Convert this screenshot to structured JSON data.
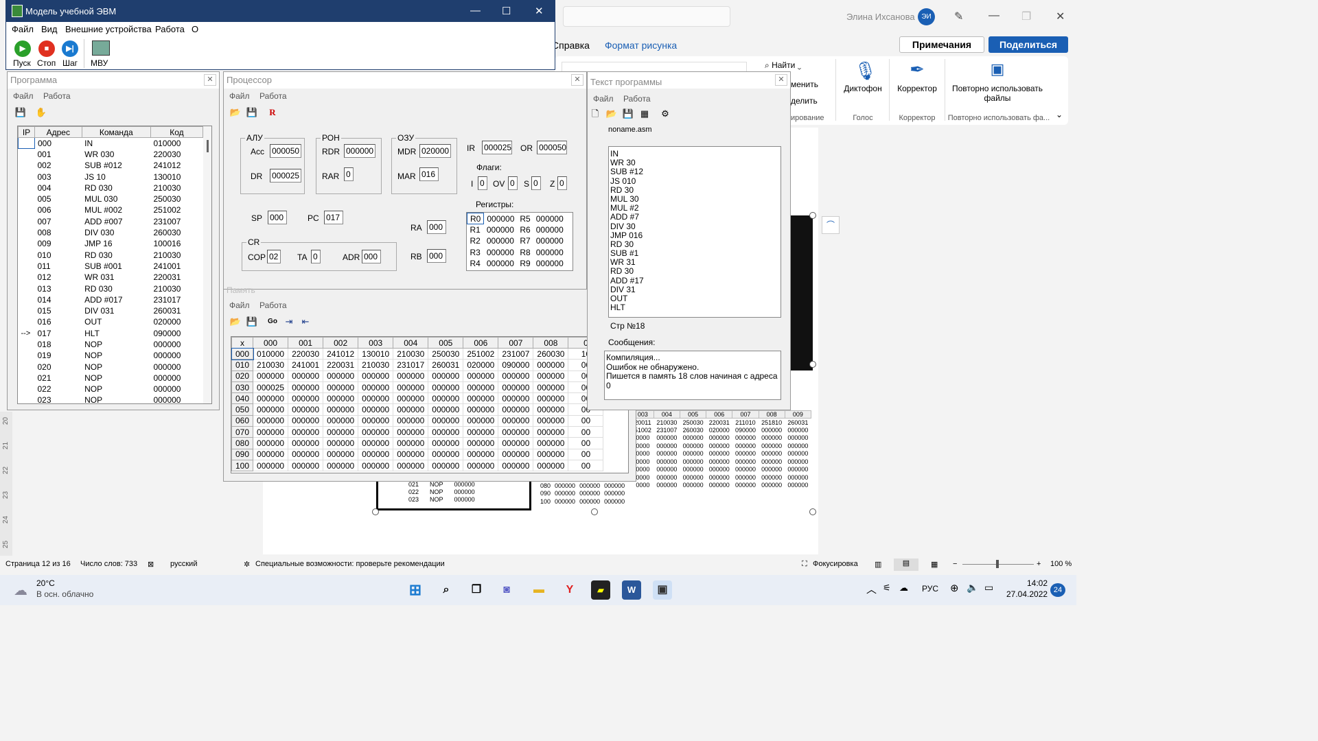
{
  "word": {
    "user_name": "Элина Ихсанова",
    "user_initials": "ЭИ",
    "menu": [
      "Справка",
      "Формат рисунка"
    ],
    "notes_button": "Примечания",
    "share_button": "Поделиться",
    "ribbon": {
      "find": "Найти",
      "replace": "менить",
      "select": "делить",
      "editing": "ирование",
      "dictation": "Диктофон",
      "voice": "Голос",
      "editor": "Корректор",
      "editor_group": "Корректор",
      "reuse": "Повторно использовать файлы",
      "reuse_group": "Повторно использовать фа..."
    },
    "status": {
      "page": "Страница 12 из 16",
      "words": "Число слов: 733",
      "language": "русский",
      "accessibility": "Специальные возможности: проверьте рекомендации",
      "focus": "Фокусировка",
      "zoom": "100 %"
    },
    "ruler": [
      "20",
      "21",
      "22",
      "23",
      "24",
      "25"
    ],
    "small_grid_header": [
      "003",
      "004",
      "005",
      "006",
      "007",
      "008",
      "009"
    ],
    "small_grid_rows": [
      [
        "20011",
        "210030",
        "250030",
        "220031",
        "211010",
        "251810",
        "260031"
      ],
      [
        "51002",
        "231007",
        "260030",
        "020000",
        "090000",
        "000000",
        "000000"
      ],
      [
        "0000",
        "000000",
        "000000",
        "000000",
        "000000",
        "000000",
        "000000"
      ],
      [
        "0000",
        "000000",
        "000000",
        "000000",
        "000000",
        "000000",
        "000000"
      ],
      [
        "0000",
        "000000",
        "000000",
        "000000",
        "000000",
        "000000",
        "000000"
      ],
      [
        "0000",
        "000000",
        "000000",
        "000000",
        "000000",
        "000000",
        "000000"
      ],
      [
        "0000",
        "000000",
        "000000",
        "000000",
        "000000",
        "000000",
        "000000"
      ],
      [
        "0000",
        "000000",
        "000000",
        "000000",
        "000000",
        "000000",
        "000000"
      ],
      [
        "0000",
        "000000",
        "000000",
        "000000",
        "000000",
        "000000",
        "000000"
      ]
    ],
    "small_grid_bottom": [
      [
        "080",
        "000000",
        "000000",
        "000000",
        "000000",
        "000000",
        "000000",
        "000000",
        "000000",
        "000000"
      ],
      [
        "090",
        "000000",
        "000000",
        "000000",
        "000000",
        "000000",
        "000000",
        "000000",
        "000000",
        "000000"
      ],
      [
        "100",
        "000000",
        "000000",
        "000000",
        "000000",
        "000000",
        "000000",
        "000000",
        "000000",
        "000000"
      ]
    ],
    "small_prog_rows": [
      [
        "021",
        "NOP",
        "000000"
      ],
      [
        "022",
        "NOP",
        "000000"
      ],
      [
        "023",
        "NOP",
        "000000"
      ]
    ]
  },
  "main_window": {
    "title": "Модель учебной ЭВМ",
    "menu": [
      "Файл",
      "Вид",
      "Внешние устройства",
      "Работа",
      "О"
    ],
    "tools": {
      "run": "Пуск",
      "stop": "Стоп",
      "step": "Шаг",
      "mvu": "МВУ"
    }
  },
  "program_window": {
    "title": "Программа",
    "menu": [
      "Файл",
      "Работа"
    ],
    "columns": [
      "IP",
      "Адрес",
      "Команда",
      "Код"
    ],
    "rows": [
      [
        "",
        "000",
        "IN",
        "010000"
      ],
      [
        "",
        "001",
        "WR 030",
        "220030"
      ],
      [
        "",
        "002",
        "SUB #012",
        "241012"
      ],
      [
        "",
        "003",
        "JS 10",
        "130010"
      ],
      [
        "",
        "004",
        "RD 030",
        "210030"
      ],
      [
        "",
        "005",
        "MUL 030",
        "250030"
      ],
      [
        "",
        "006",
        "MUL #002",
        "251002"
      ],
      [
        "",
        "007",
        "ADD #007",
        "231007"
      ],
      [
        "",
        "008",
        "DIV 030",
        "260030"
      ],
      [
        "",
        "009",
        "JMP 16",
        "100016"
      ],
      [
        "",
        "010",
        "RD 030",
        "210030"
      ],
      [
        "",
        "011",
        "SUB #001",
        "241001"
      ],
      [
        "",
        "012",
        "WR 031",
        "220031"
      ],
      [
        "",
        "013",
        "RD 030",
        "210030"
      ],
      [
        "",
        "014",
        "ADD #017",
        "231017"
      ],
      [
        "",
        "015",
        "DIV 031",
        "260031"
      ],
      [
        "",
        "016",
        "OUT",
        "020000"
      ],
      [
        "-->",
        "017",
        "HLT",
        "090000"
      ],
      [
        "",
        "018",
        "NOP",
        "000000"
      ],
      [
        "",
        "019",
        "NOP",
        "000000"
      ],
      [
        "",
        "020",
        "NOP",
        "000000"
      ],
      [
        "",
        "021",
        "NOP",
        "000000"
      ],
      [
        "",
        "022",
        "NOP",
        "000000"
      ],
      [
        "",
        "023",
        "NOP",
        "000000"
      ]
    ]
  },
  "processor_window": {
    "title": "Процессор",
    "menu": [
      "Файл",
      "Работа"
    ],
    "alu": {
      "label": "АЛУ",
      "acc_label": "Acc",
      "acc": "000050",
      "dr_label": "DR",
      "dr": "000025"
    },
    "ron": {
      "label": "РОН",
      "rdr_label": "RDR",
      "rdr": "000000",
      "rar_label": "RAR",
      "rar": "0"
    },
    "ozu": {
      "label": "ОЗУ",
      "mdr_label": "MDR",
      "mdr": "020000",
      "mar_label": "MAR",
      "mar": "016"
    },
    "ir_label": "IR",
    "ir": "000025",
    "or_label": "OR",
    "or": "000050",
    "flags_label": "Флаги:",
    "flags": [
      {
        "name": "I",
        "value": "0"
      },
      {
        "name": "OV",
        "value": "0"
      },
      {
        "name": "S",
        "value": "0"
      },
      {
        "name": "Z",
        "value": "0"
      }
    ],
    "regs_label": "Регистры:",
    "regs": [
      [
        "R0",
        "000000",
        "R5",
        "000000"
      ],
      [
        "R1",
        "000000",
        "R6",
        "000000"
      ],
      [
        "R2",
        "000000",
        "R7",
        "000000"
      ],
      [
        "R3",
        "000000",
        "R8",
        "000000"
      ],
      [
        "R4",
        "000000",
        "R9",
        "000000"
      ]
    ],
    "sp_label": "SP",
    "sp": "000",
    "pc_label": "PC",
    "pc": "017",
    "ra_label": "RA",
    "ra": "000",
    "rb_label": "RB",
    "rb": "000",
    "cr": {
      "label": "CR",
      "cop_label": "COP",
      "cop": "02",
      "ta_label": "TA",
      "ta": "0",
      "adr_label": "ADR",
      "adr": "000"
    }
  },
  "memory_window": {
    "title": "Память",
    "menu": [
      "Файл",
      "Работа"
    ],
    "columns": [
      "x",
      "000",
      "001",
      "002",
      "003",
      "004",
      "005",
      "006",
      "007",
      "008",
      "0"
    ],
    "rows": [
      [
        "000",
        "010000",
        "220030",
        "241012",
        "130010",
        "210030",
        "250030",
        "251002",
        "231007",
        "260030",
        "10"
      ],
      [
        "010",
        "210030",
        "241001",
        "220031",
        "210030",
        "231017",
        "260031",
        "020000",
        "090000",
        "000000",
        "00"
      ],
      [
        "020",
        "000000",
        "000000",
        "000000",
        "000000",
        "000000",
        "000000",
        "000000",
        "000000",
        "000000",
        "00"
      ],
      [
        "030",
        "000025",
        "000000",
        "000000",
        "000000",
        "000000",
        "000000",
        "000000",
        "000000",
        "000000",
        "00"
      ],
      [
        "040",
        "000000",
        "000000",
        "000000",
        "000000",
        "000000",
        "000000",
        "000000",
        "000000",
        "000000",
        "00"
      ],
      [
        "050",
        "000000",
        "000000",
        "000000",
        "000000",
        "000000",
        "000000",
        "000000",
        "000000",
        "000000",
        "00"
      ],
      [
        "060",
        "000000",
        "000000",
        "000000",
        "000000",
        "000000",
        "000000",
        "000000",
        "000000",
        "000000",
        "00"
      ],
      [
        "070",
        "000000",
        "000000",
        "000000",
        "000000",
        "000000",
        "000000",
        "000000",
        "000000",
        "000000",
        "00"
      ],
      [
        "080",
        "000000",
        "000000",
        "000000",
        "000000",
        "000000",
        "000000",
        "000000",
        "000000",
        "000000",
        "00"
      ],
      [
        "090",
        "000000",
        "000000",
        "000000",
        "000000",
        "000000",
        "000000",
        "000000",
        "000000",
        "000000",
        "00"
      ],
      [
        "100",
        "000000",
        "000000",
        "000000",
        "000000",
        "000000",
        "000000",
        "000000",
        "000000",
        "000000",
        "00"
      ]
    ]
  },
  "source_window": {
    "title": "Текст программы",
    "menu": [
      "Файл",
      "Работа"
    ],
    "filename": "noname.asm",
    "lines": [
      "IN",
      "WR 30",
      "SUB #12",
      "JS 010",
      "RD 30",
      "MUL 30",
      "MUL #2",
      "ADD #7",
      "DIV 30",
      "JMP 016",
      "RD 30",
      "SUB #1",
      "WR 31",
      "RD 30",
      "ADD #17",
      "DIV 31",
      "OUT",
      "HLT"
    ],
    "line_status": "Стр №18",
    "messages_label": "Сообщения:",
    "messages": [
      "Компиляция...",
      "Ошибок не обнаружено.",
      "Пишется в память 18 слов начиная с адреса 0"
    ]
  },
  "taskbar": {
    "temperature": "20°C",
    "weather": "В осн. облачно",
    "lang": "РУС",
    "time": "14:02",
    "date": "27.04.2022",
    "notifications": "24"
  },
  "colors": {
    "title_blue": "#1f3e6e",
    "accent": "#1a5fb4"
  }
}
